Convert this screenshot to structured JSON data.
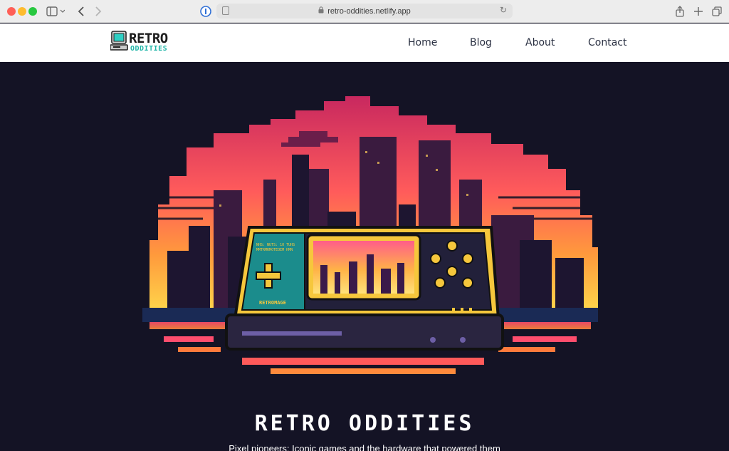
{
  "browser": {
    "url": "retro-oddities.netlify.app"
  },
  "header": {
    "logo_title": "RETRO",
    "logo_subtitle": "ODDITIES",
    "nav": [
      {
        "label": "Home"
      },
      {
        "label": "Blog"
      },
      {
        "label": "About"
      },
      {
        "label": "Contact"
      }
    ]
  },
  "hero": {
    "title": "RETRO ODDITIES",
    "subtitle": "Pixel pioneers: Iconic games and the hardware that powered them",
    "console_brand": "RETROMAGE",
    "colors": {
      "background": "#141325",
      "sky_top": "#e83a7a",
      "sky_bottom": "#ffc13b",
      "console_body": "#f6c73c",
      "console_panel": "#1b8c8c"
    }
  }
}
